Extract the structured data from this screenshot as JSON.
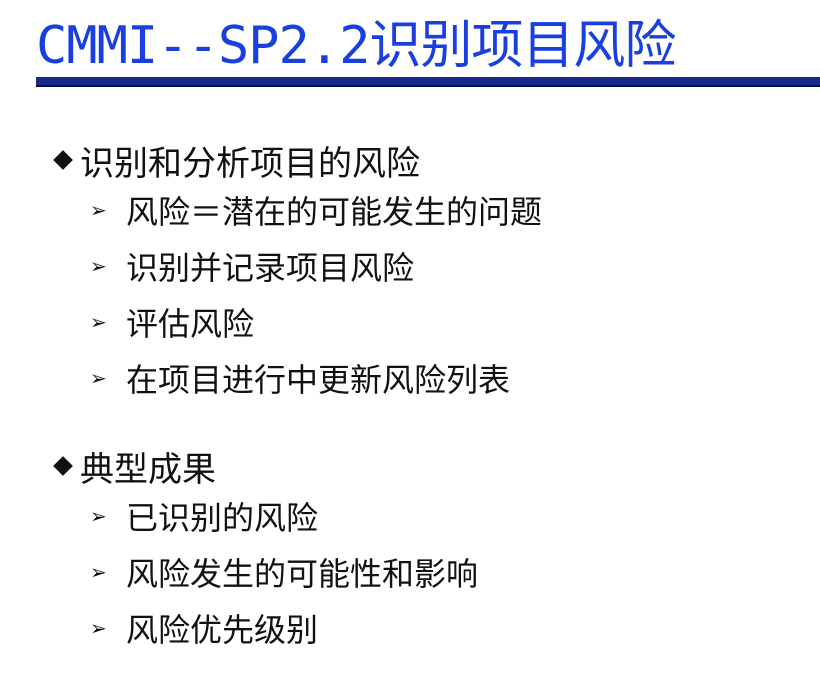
{
  "slide": {
    "title": "CMMI--SP2.2识别项目风险"
  },
  "sections": [
    {
      "heading": "识别和分析项目的风险",
      "items": [
        "风险＝潜在的可能发生的问题",
        "识别并记录项目风险",
        "评估风险",
        "在项目进行中更新风险列表"
      ]
    },
    {
      "heading": "典型成果",
      "items": [
        "已识别的风险",
        "风险发生的可能性和影响",
        "风险优先级别"
      ]
    }
  ],
  "colors": {
    "title": "#1a3fe0",
    "rule": "#1a2a8c"
  },
  "icons": {
    "section_bullet": "diamond-bullet-icon",
    "item_bullet": "arrow-bullet-icon"
  }
}
